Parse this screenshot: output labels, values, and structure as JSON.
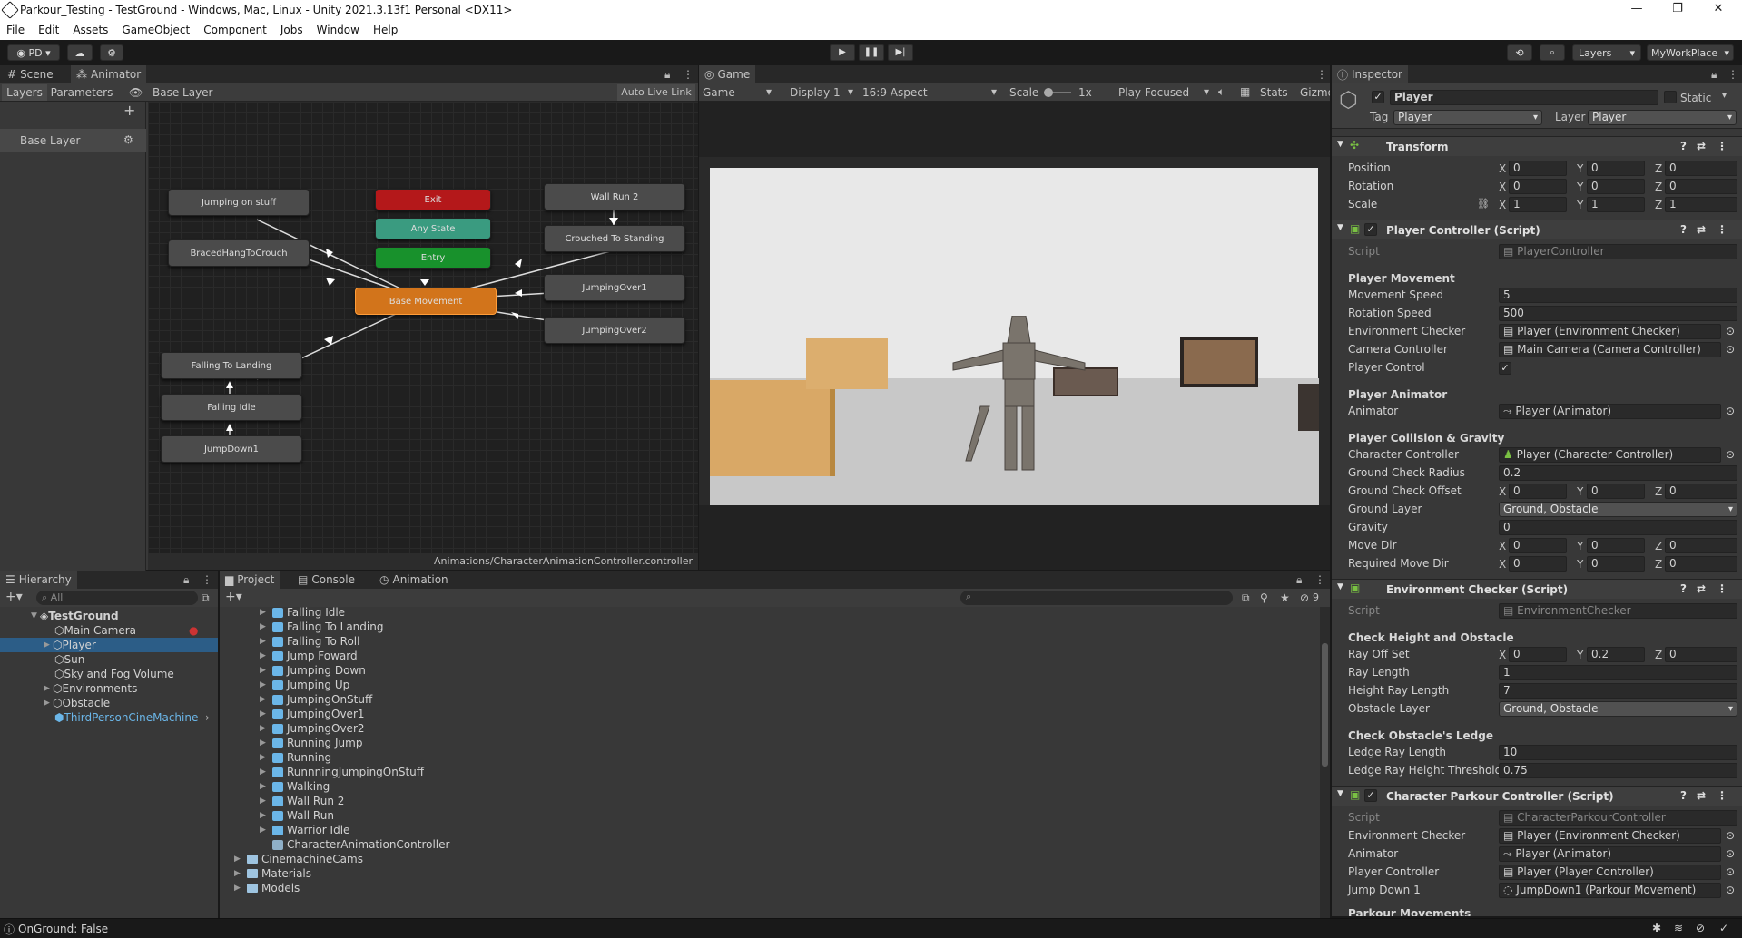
{
  "window": {
    "title": "Parkour_Testing - TestGround - Windows, Mac, Linux - Unity 2021.3.13f1 Personal <DX11>",
    "minimize": "—",
    "maximize": "❐",
    "close": "✕"
  },
  "menu": [
    "File",
    "Edit",
    "Assets",
    "GameObject",
    "Component",
    "Jobs",
    "Window",
    "Help"
  ],
  "toolbar": {
    "account": "PD",
    "layers": "Layers",
    "layout": "MyWorkPlace"
  },
  "scene_tabs": {
    "scene": "Scene",
    "animator": "Animator"
  },
  "animator": {
    "layers_tab": "Layers",
    "parameters_tab": "Parameters",
    "breadcrumb": "Base Layer",
    "auto_live": "Auto Live Link",
    "layer_name": "Base Layer",
    "path": "Animations/CharacterAnimationController.controller",
    "nodes": {
      "jumping_on_stuff": "Jumping on stuff",
      "braced": "BracedHangToCrouch",
      "exit": "Exit",
      "any_state": "Any State",
      "entry": "Entry",
      "base_movement": "Base Movement",
      "wall_run_2": "Wall Run 2",
      "crouched": "Crouched To Standing",
      "jumping_over1": "JumpingOver1",
      "jumping_over2": "JumpingOver2",
      "falling_to_landing": "Falling To Landing",
      "falling_idle": "Falling Idle",
      "jumpdown1": "JumpDown1"
    }
  },
  "game": {
    "tab": "Game",
    "mode": "Game",
    "display": "Display 1",
    "aspect": "16:9 Aspect",
    "scale_label": "Scale",
    "scale_value": "1x",
    "play_focused": "Play Focused",
    "stats": "Stats",
    "gizmos": "Gizmos"
  },
  "hierarchy": {
    "tab": "Hierarchy",
    "search_placeholder": "All",
    "scene": "TestGround",
    "items": [
      "Main Camera",
      "Player",
      "Sun",
      "Sky and Fog Volume",
      "Environments",
      "Obstacle",
      "ThirdPersonCineMachine"
    ]
  },
  "project": {
    "tabs": [
      "Project",
      "Console",
      "Animation"
    ],
    "count": "9",
    "items": [
      "Falling Idle",
      "Falling To Landing",
      "Falling To Roll",
      "Jump Foward",
      "Jumping Down",
      "Jumping Up",
      "JumpingOnStuff",
      "JumpingOver1",
      "JumpingOver2",
      "Running Jump",
      "Running",
      "RunnningJumpingOnStuff",
      "Walking",
      "Wall Run 2",
      "Wall Run",
      "Warrior Idle"
    ],
    "controller": "CharacterAnimationController",
    "folders": [
      "CinemachineCams",
      "Materials",
      "Models"
    ]
  },
  "inspector": {
    "tab": "Inspector",
    "object_name": "Player",
    "static_label": "Static",
    "tag_label": "Tag",
    "tag_value": "Player",
    "layer_label": "Layer",
    "layer_value": "Player",
    "transform": {
      "title": "Transform",
      "position": "Position",
      "rotation": "Rotation",
      "scale": "Scale",
      "pos": [
        "0",
        "0",
        "0"
      ],
      "rot": [
        "0",
        "0",
        "0"
      ],
      "scl": [
        "1",
        "1",
        "1"
      ]
    },
    "player_controller": {
      "title": "Player Controller (Script)",
      "script_label": "Script",
      "script": "PlayerController",
      "movement_header": "Player Movement",
      "movement_speed_label": "Movement Speed",
      "movement_speed": "5",
      "rotation_speed_label": "Rotation Speed",
      "rotation_speed": "500",
      "env_checker_label": "Environment Checker",
      "env_checker": "Player (Environment Checker)",
      "camera_controller_label": "Camera Controller",
      "camera_controller": "Main Camera (Camera Controller)",
      "player_control_label": "Player Control",
      "animator_header": "Player Animator",
      "animator_label": "Animator",
      "animator": "Player (Animator)",
      "collision_header": "Player Collision & Gravity",
      "char_controller_label": "Character Controller",
      "char_controller": "Player (Character Controller)",
      "ground_radius_label": "Ground Check Radius",
      "ground_radius": "0.2",
      "ground_offset_label": "Ground Check Offset",
      "ground_offset": [
        "0",
        "0",
        "0"
      ],
      "ground_layer_label": "Ground Layer",
      "ground_layer": "Ground, Obstacle",
      "gravity_label": "Gravity",
      "gravity": "0",
      "move_dir_label": "Move Dir",
      "move_dir": [
        "0",
        "0",
        "0"
      ],
      "req_move_dir_label": "Required Move Dir",
      "req_move_dir": [
        "0",
        "0",
        "0"
      ]
    },
    "env_checker": {
      "title": "Environment Checker (Script)",
      "script_label": "Script",
      "script": "EnvironmentChecker",
      "height_header": "Check Height and Obstacle",
      "ray_offset_label": "Ray Off Set",
      "ray_offset": [
        "0",
        "0.2",
        "0"
      ],
      "ray_length_label": "Ray Length",
      "ray_length": "1",
      "height_ray_label": "Height Ray Length",
      "height_ray": "7",
      "obstacle_layer_label": "Obstacle Layer",
      "obstacle_layer": "Ground, Obstacle",
      "ledge_header": "Check Obstacle's Ledge",
      "ledge_ray_label": "Ledge Ray Length",
      "ledge_ray": "10",
      "ledge_threshold_label": "Ledge Ray Height Threshold",
      "ledge_threshold": "0.75"
    },
    "parkour": {
      "title": "Character Parkour Controller (Script)",
      "script_label": "Script",
      "script": "CharacterParkourController",
      "env_checker_label": "Environment Checker",
      "env_checker": "Player (Environment Checker)",
      "animator_label": "Animator",
      "animator": "Player (Animator)",
      "player_controller_label": "Player Controller",
      "player_controller": "Player (Player Controller)",
      "jump_down_label": "Jump Down 1",
      "jump_down": "JumpDown1 (Parkour Movement)",
      "movements_header": "Parkour Movements"
    }
  },
  "status": {
    "message": "OnGround: False"
  }
}
